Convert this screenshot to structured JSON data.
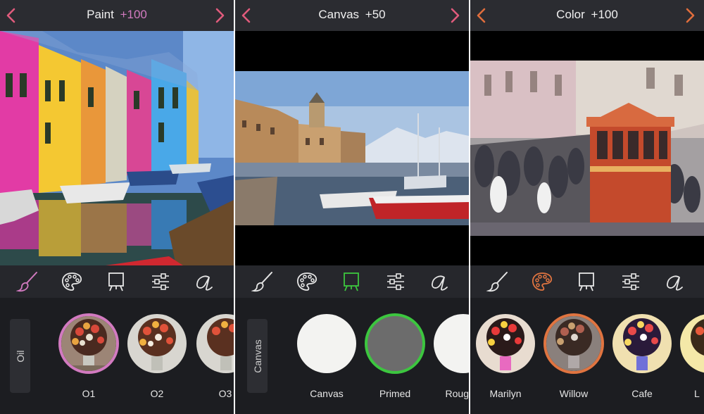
{
  "colors": {
    "paint_accent": "#d27ac0",
    "canvas_accent": "#3cc63f",
    "color_accent": "#e07440",
    "nav_arrow_pink": "#e05b7c",
    "nav_arrow_orange": "#e06d3c"
  },
  "panels": [
    {
      "title": "Paint",
      "amount": "+100",
      "category": "Oil",
      "items": [
        "O1",
        "O2",
        "O3"
      ],
      "selected_index": 0,
      "active_tool": "brush-icon"
    },
    {
      "title": "Canvas",
      "amount": "+50",
      "category": "Canvas",
      "items": [
        "Canvas",
        "Primed",
        "Roug"
      ],
      "selected_index": 1,
      "active_tool": "easel-icon"
    },
    {
      "title": "Color",
      "amount": "+100",
      "category": "",
      "items": [
        "Marilyn",
        "Willow",
        "Cafe",
        "L"
      ],
      "selected_index": 1,
      "active_tool": "palette-icon"
    }
  ],
  "tools": [
    "brush-icon",
    "palette-icon",
    "easel-icon",
    "sliders-icon",
    "text-style-icon"
  ]
}
